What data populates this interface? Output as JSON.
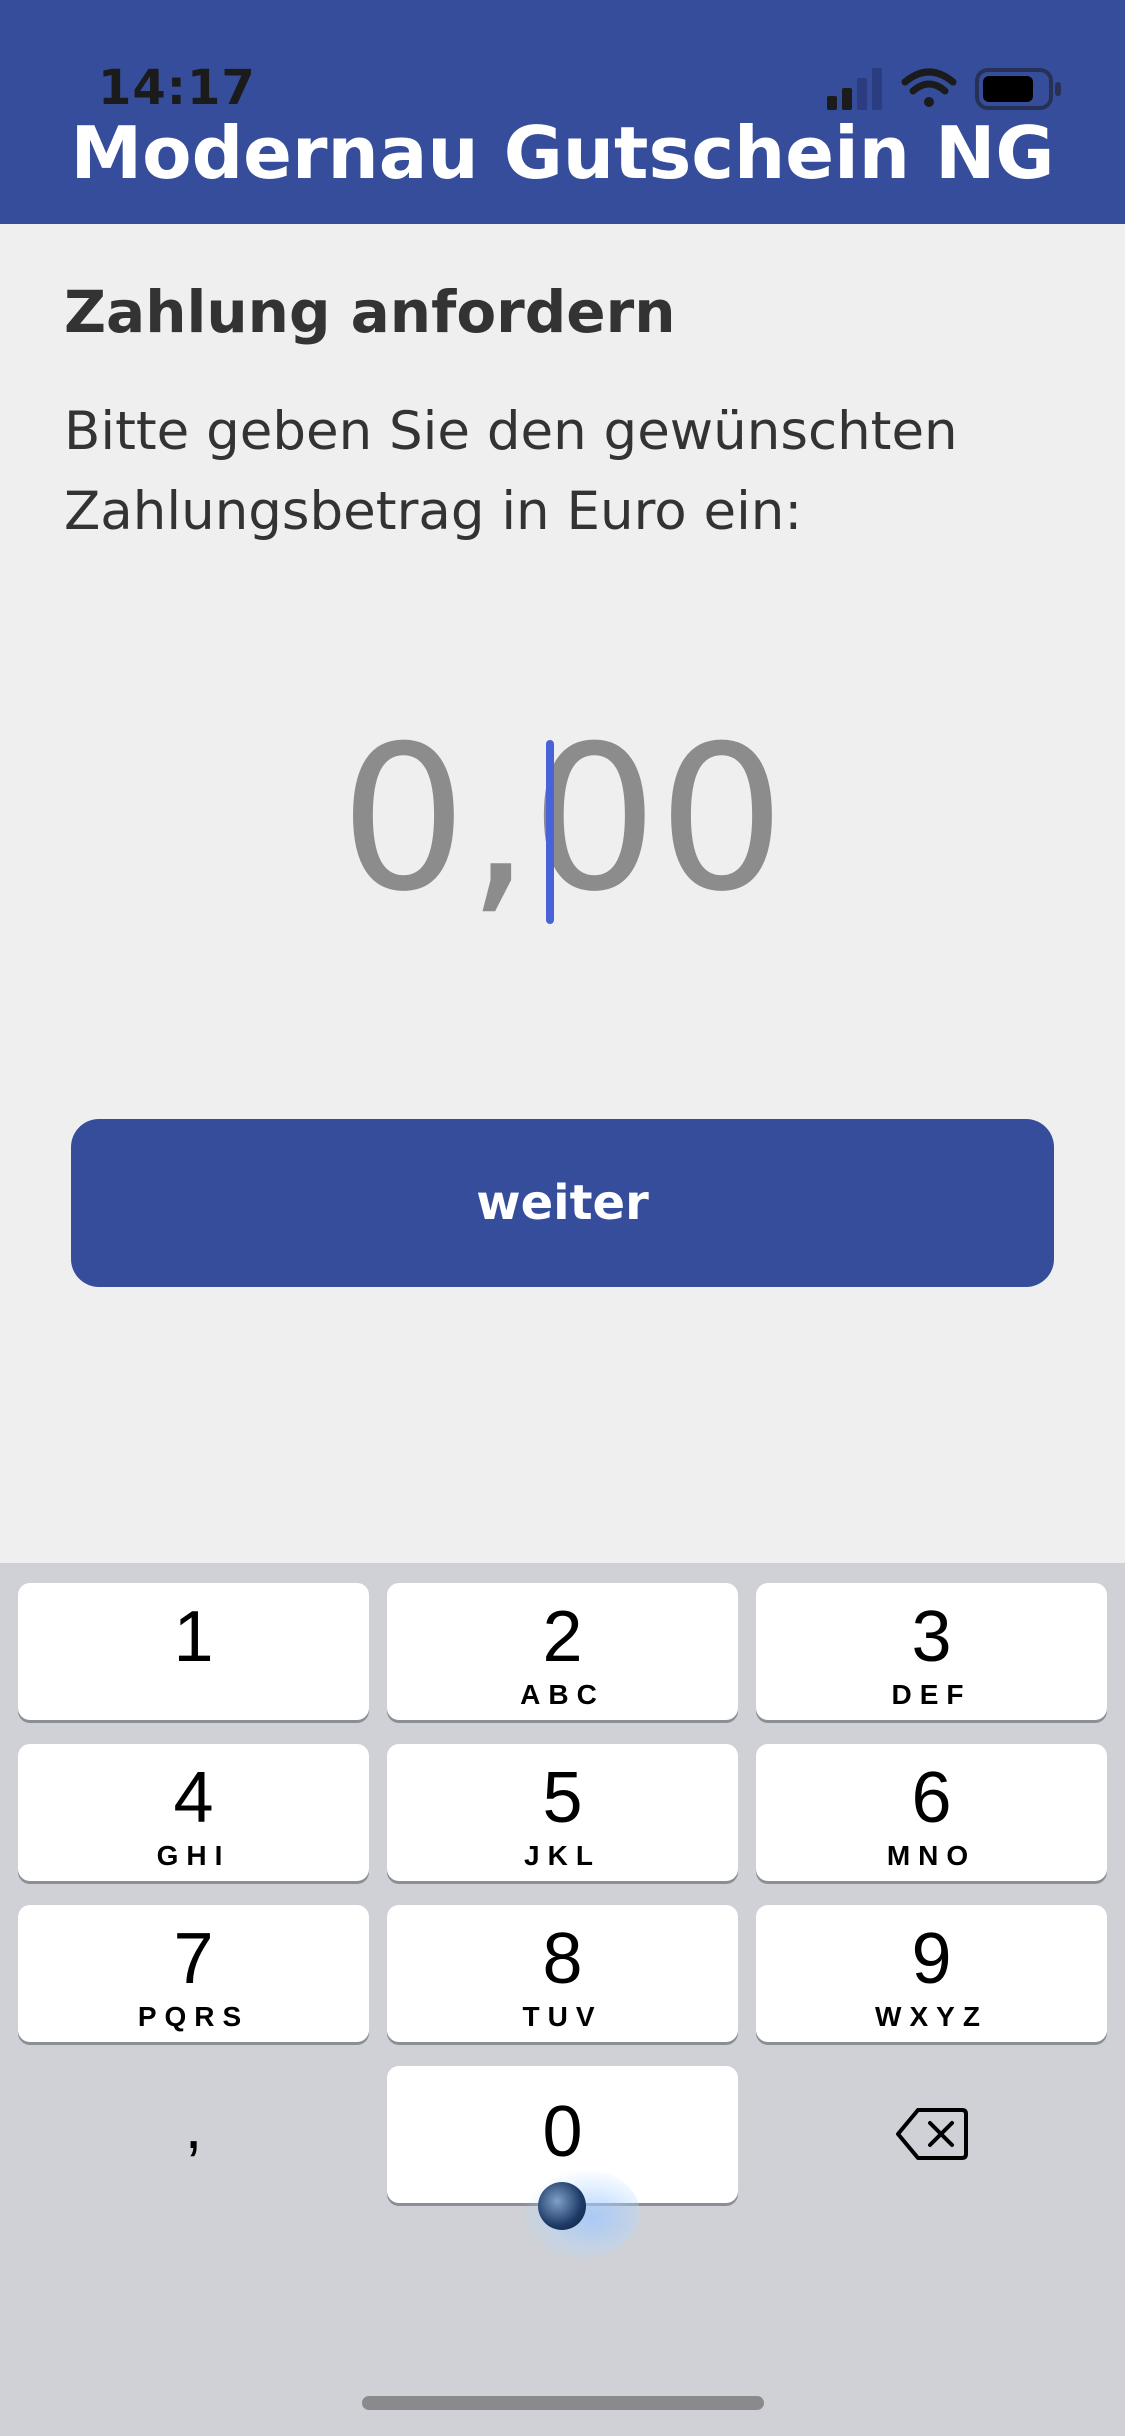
{
  "status_bar": {
    "time": "14:17"
  },
  "header": {
    "title": "Modernau Gutschein NG"
  },
  "content": {
    "title": "Zahlung anfordern",
    "description": "Bitte geben Sie den gewünschten Zahlungsbetrag in Euro ein:"
  },
  "amount": {
    "value": "0,00"
  },
  "button": {
    "label": "weiter"
  },
  "keypad": {
    "k1": {
      "digit": "1",
      "letters": ""
    },
    "k2": {
      "digit": "2",
      "letters": "ABC"
    },
    "k3": {
      "digit": "3",
      "letters": "DEF"
    },
    "k4": {
      "digit": "4",
      "letters": "GHI"
    },
    "k5": {
      "digit": "5",
      "letters": "JKL"
    },
    "k6": {
      "digit": "6",
      "letters": "MNO"
    },
    "k7": {
      "digit": "7",
      "letters": "PQRS"
    },
    "k8": {
      "digit": "8",
      "letters": "TUV"
    },
    "k9": {
      "digit": "9",
      "letters": "WXYZ"
    },
    "comma": ",",
    "k0": {
      "digit": "0"
    },
    "delete_icon": "backspace-icon"
  },
  "colors": {
    "header_bg": "#364d9c",
    "button_bg": "#364d9c",
    "cursor": "#4a62d8",
    "keyboard_bg": "#cfd1d6"
  }
}
